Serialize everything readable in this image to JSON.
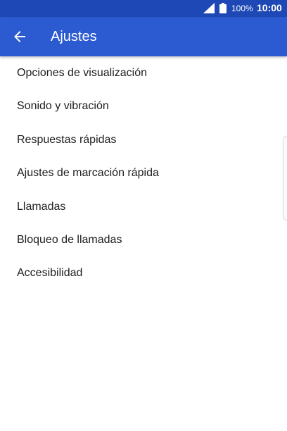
{
  "status_bar": {
    "battery_level": "100%",
    "time": "10:00",
    "icons": [
      "signal-icon",
      "battery-icon"
    ]
  },
  "app_bar": {
    "title": "Ajustes",
    "back_icon": "arrow-back-icon"
  },
  "settings_menu": {
    "items": [
      {
        "label": "Opciones de visualización"
      },
      {
        "label": "Sonido y vibración"
      },
      {
        "label": "Respuestas rápidas"
      },
      {
        "label": "Ajustes de marcación rápida"
      },
      {
        "label": "Llamadas"
      },
      {
        "label": "Bloqueo de llamadas"
      },
      {
        "label": "Accesibilidad"
      }
    ]
  },
  "colors": {
    "status_bar": "#1e48b5",
    "app_bar": "#2b5ad1",
    "text": "#202020",
    "background": "#ffffff"
  }
}
